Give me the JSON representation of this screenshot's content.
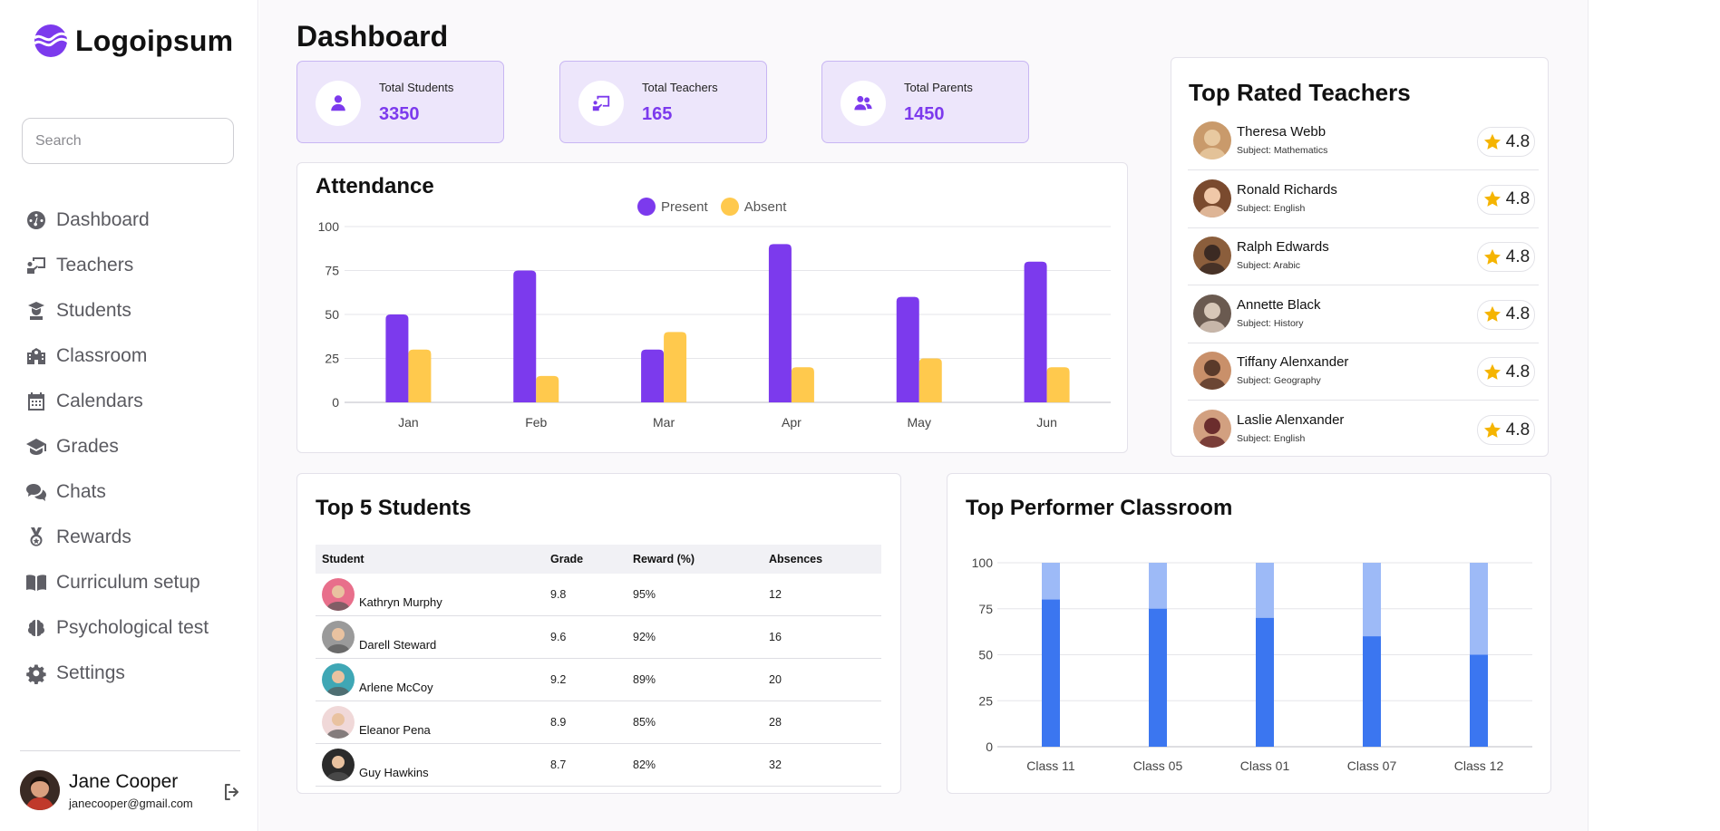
{
  "brand": {
    "name": "Logoipsum"
  },
  "search": {
    "placeholder": "Search"
  },
  "nav": [
    {
      "label": "Dashboard",
      "icon": "gauge-icon"
    },
    {
      "label": "Teachers",
      "icon": "teacher-board-icon"
    },
    {
      "label": "Students",
      "icon": "graduation-cap-icon"
    },
    {
      "label": "Classroom",
      "icon": "school-icon"
    },
    {
      "label": "Calendars",
      "icon": "calendar-icon"
    },
    {
      "label": "Grades",
      "icon": "mortarboard-icon"
    },
    {
      "label": "Chats",
      "icon": "chat-bubbles-icon"
    },
    {
      "label": "Rewards",
      "icon": "medal-icon"
    },
    {
      "label": "Curriculum setup",
      "icon": "book-icon"
    },
    {
      "label": "Psychological test",
      "icon": "brain-icon"
    },
    {
      "label": "Settings",
      "icon": "gear-icon"
    }
  ],
  "user": {
    "name": "Jane Cooper",
    "email": "janecooper@gmail.com"
  },
  "page": {
    "title": "Dashboard"
  },
  "stats": [
    {
      "label": "Total Students",
      "value": "3350",
      "icon": "user-icon"
    },
    {
      "label": "Total Teachers",
      "value": "165",
      "icon": "presentation-icon"
    },
    {
      "label": "Total Parents",
      "value": "1450",
      "icon": "users-icon"
    }
  ],
  "attendance": {
    "title": "Attendance",
    "legend": {
      "present": "Present",
      "absent": "Absent"
    }
  },
  "top_teachers": {
    "title": "Top Rated Teachers",
    "items": [
      {
        "name": "Theresa Webb",
        "subject": "Subject: Mathematics",
        "rating": "4.8"
      },
      {
        "name": "Ronald Richards",
        "subject": "Subject: English",
        "rating": "4.8"
      },
      {
        "name": "Ralph Edwards",
        "subject": "Subject: Arabic",
        "rating": "4.8"
      },
      {
        "name": "Annette Black",
        "subject": "Subject: History",
        "rating": "4.8"
      },
      {
        "name": "Tiffany Alenxander",
        "subject": "Subject: Geography",
        "rating": "4.8"
      },
      {
        "name": "Laslie Alenxander",
        "subject": "Subject: English",
        "rating": "4.8"
      }
    ]
  },
  "top_students": {
    "title": "Top 5 Students",
    "columns": [
      "Student",
      "Grade",
      "Reward (%)",
      "Absences"
    ],
    "rows": [
      {
        "name": "Kathryn Murphy",
        "grade": "9.8",
        "reward": "95%",
        "absences": "12"
      },
      {
        "name": "Darell Steward",
        "grade": "9.6",
        "reward": "92%",
        "absences": "16"
      },
      {
        "name": "Arlene McCoy",
        "grade": "9.2",
        "reward": "89%",
        "absences": "20"
      },
      {
        "name": "Eleanor Pena",
        "grade": "8.9",
        "reward": "85%",
        "absences": "28"
      },
      {
        "name": "Guy Hawkins",
        "grade": "8.7",
        "reward": "82%",
        "absences": "32"
      }
    ]
  },
  "top_classroom": {
    "title": "Top Performer Classroom"
  },
  "colors": {
    "accent": "#7c3aed",
    "present": "#7c3aed",
    "absent": "#ffc94d",
    "classroom_fill": "#3b76f0",
    "classroom_rest": "#9dbaf7",
    "star": "#f5b400"
  },
  "chart_data": [
    {
      "type": "bar",
      "title": "Attendance",
      "categories": [
        "Jan",
        "Feb",
        "Mar",
        "Apr",
        "May",
        "Jun"
      ],
      "series": [
        {
          "name": "Present",
          "values": [
            50,
            75,
            30,
            90,
            60,
            80
          ]
        },
        {
          "name": "Absent",
          "values": [
            30,
            15,
            40,
            20,
            25,
            20
          ]
        }
      ],
      "yticks": [
        0,
        25,
        50,
        75,
        100
      ],
      "ylim": [
        0,
        100
      ],
      "legend": "top-center",
      "grid": true
    },
    {
      "type": "bar",
      "title": "Top Performer Classroom",
      "stacked": true,
      "categories": [
        "Class 11",
        "Class 05",
        "Class 01",
        "Class 07",
        "Class 12"
      ],
      "values": [
        80,
        75,
        70,
        60,
        50
      ],
      "total": 100,
      "yticks": [
        0,
        25,
        50,
        75,
        100
      ],
      "ylim": [
        0,
        100
      ],
      "grid": true
    }
  ]
}
